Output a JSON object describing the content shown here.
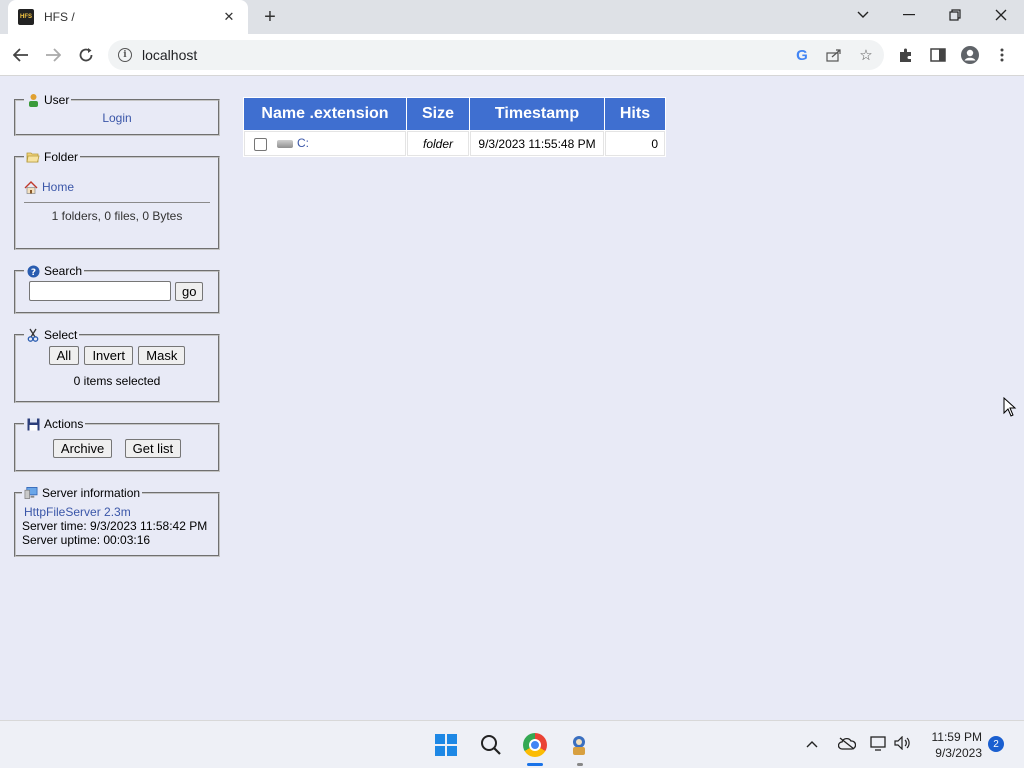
{
  "browser": {
    "tab_title": "HFS /",
    "favicon_text": "HFS",
    "url": "localhost"
  },
  "sidebar": {
    "user": {
      "legend": "User",
      "login_link": "Login"
    },
    "folder": {
      "legend": "Folder",
      "home_link": "Home",
      "summary": "1 folders, 0 files, 0 Bytes"
    },
    "search": {
      "legend": "Search",
      "input_value": "",
      "go_label": "go"
    },
    "select": {
      "legend": "Select",
      "all_label": "All",
      "invert_label": "Invert",
      "mask_label": "Mask",
      "status": "0 items selected"
    },
    "actions": {
      "legend": "Actions",
      "archive_label": "Archive",
      "getlist_label": "Get list"
    },
    "server": {
      "legend": "Server information",
      "version_link": "HttpFileServer 2.3m",
      "time": "Server time: 9/3/2023 11:58:42 PM",
      "uptime": "Server uptime: 00:03:16"
    }
  },
  "filelist": {
    "columns": [
      "Name .extension",
      "Size",
      "Timestamp",
      "Hits"
    ],
    "rows": [
      {
        "name": "C:",
        "size": "folder",
        "timestamp": "9/3/2023 11:55:48 PM",
        "hits": "0"
      }
    ]
  },
  "taskbar": {
    "time": "11:59 PM",
    "date": "9/3/2023",
    "notification_count": "2"
  }
}
